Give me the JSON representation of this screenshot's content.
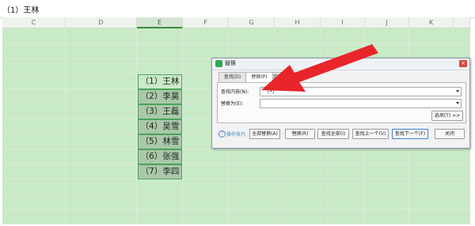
{
  "formula_bar": {
    "text": "（1）王林"
  },
  "columns": [
    "C",
    "D",
    "E",
    "F",
    "G",
    "H",
    "I",
    "J",
    "K"
  ],
  "selected_column": "E",
  "cells": [
    "（1）王林",
    "（2）李昊",
    "（3）王磊",
    "（4）吴雪",
    "（5）林雪",
    "（6）张强",
    "（7）李四"
  ],
  "dialog": {
    "title": "替换",
    "close": "×",
    "tabs": [
      "查找(D)",
      "替换(P)",
      "定位(G)"
    ],
    "active_tab": "替换(P)",
    "find_label": "查找内容(N):",
    "find_value": "（*）",
    "replace_label": "替换为(E):",
    "replace_value": "",
    "options_button": "选项(T) >>",
    "tips": "操作技巧",
    "buttons": {
      "replace_all": "全部替换(A)",
      "replace": "替换(R)",
      "find_all": "查找全部(I)",
      "find_prev": "查找上一个(V)",
      "find_next": "查找下一个(F)",
      "close": "关闭"
    }
  },
  "colors": {
    "sheet": "#c9eac7",
    "selection_border": "#4aa35a",
    "arrow": "#e8252b"
  }
}
